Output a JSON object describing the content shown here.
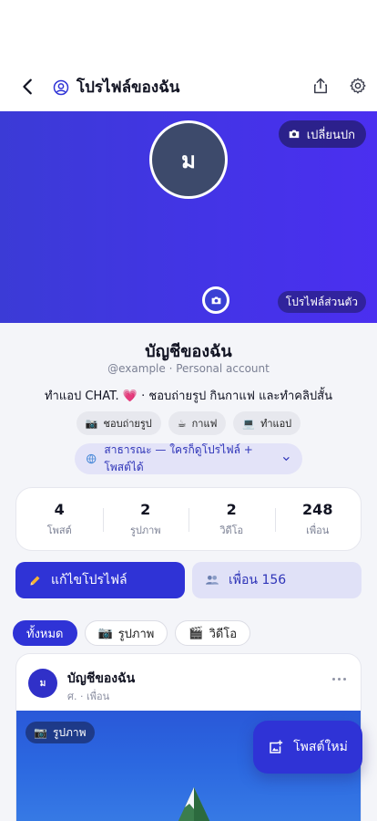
{
  "header": {
    "title": "โปรไฟล์ของฉัน"
  },
  "cover": {
    "change_cover_label": "เปลี่ยนปก",
    "private_label": "โปรไฟล์ส่วนตัว",
    "color_start": "#3b3bd6",
    "color_end": "#4b2ff0"
  },
  "profile": {
    "avatar_letter": "ม",
    "display_name": "บัญชีของฉัน",
    "handle": "@example · Personal account",
    "bio": "ทำแอป CHAT. 💗 · ชอบถ่ายรูป กินกาแฟ และทำคลิปสั้น",
    "interests": [
      {
        "icon": "📷",
        "label": "ชอบถ่ายรูป"
      },
      {
        "icon": "☕",
        "label": "กาแฟ"
      },
      {
        "icon": "💻",
        "label": "ทำแอป"
      }
    ],
    "privacy": "สาธารณะ — ใครก็ดูโปรไฟล์ + โพสต์ได้"
  },
  "stats": [
    {
      "value": "4",
      "label": "โพสต์"
    },
    {
      "value": "2",
      "label": "รูปภาพ"
    },
    {
      "value": "2",
      "label": "วิดีโอ"
    },
    {
      "value": "248",
      "label": "เพื่อน"
    }
  ],
  "actions": {
    "edit_label": "แก้ไขโปรไฟล์",
    "friends_label": "เพื่อน 156"
  },
  "filters": [
    {
      "icon": "",
      "label": "ทั้งหมด",
      "active": true
    },
    {
      "icon": "📷",
      "label": "รูปภาพ",
      "active": false
    },
    {
      "icon": "🎬",
      "label": "วิดีโอ",
      "active": false
    }
  ],
  "post": {
    "avatar_letter": "ม",
    "author": "บัญชีของฉัน",
    "meta": "ศ. · เพื่อน",
    "media_type": "รูปภาพ",
    "media_icon": "📷"
  },
  "fab": {
    "label": "โพสต์ใหม่"
  },
  "accent": "#2f33d6"
}
